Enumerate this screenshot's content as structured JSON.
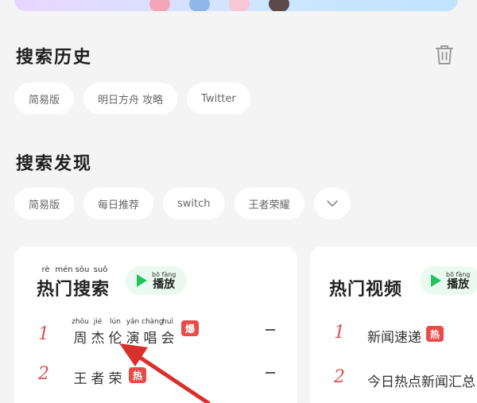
{
  "history": {
    "title": "搜索历史",
    "items": [
      "简易版",
      "明日方舟 攻略",
      "Twitter"
    ]
  },
  "discover": {
    "title": "搜索发现",
    "items": [
      "简易版",
      "每日推荐",
      "switch",
      "王者荣耀"
    ]
  },
  "hot_search": {
    "title_pinyin": [
      "rè",
      "mén",
      "sōu",
      "suǒ"
    ],
    "title_chars": [
      "热",
      "门",
      "搜",
      "索"
    ],
    "play_pinyin": "bō fàng",
    "play_label": "播放",
    "items": [
      {
        "rank": "1",
        "pinyin": [
          "zhōu",
          "jié",
          "lún",
          "yǎn",
          "chàng",
          "huì"
        ],
        "chars": [
          "周",
          "杰",
          "伦",
          "演",
          "唱",
          "会"
        ],
        "tag": "爆",
        "trend": "–"
      },
      {
        "rank": "2",
        "pinyin": [
          "",
          "",
          ""
        ],
        "chars": [
          "王",
          "者",
          "荣"
        ],
        "tag": "热",
        "trend": "–"
      }
    ]
  },
  "trending": {
    "title": "热门视频",
    "play_pinyin": "bō fàng",
    "play_label": "播放",
    "items": [
      {
        "rank": "1",
        "text": "新闻速递",
        "tag": "热"
      },
      {
        "rank": "2",
        "text": "今日热点新闻汇总"
      }
    ]
  },
  "colors": {
    "accent_green": "#22c35e",
    "rank_red": "#e0504f",
    "tag_red": "#e94a4a",
    "arrow_red": "#d8302d"
  }
}
